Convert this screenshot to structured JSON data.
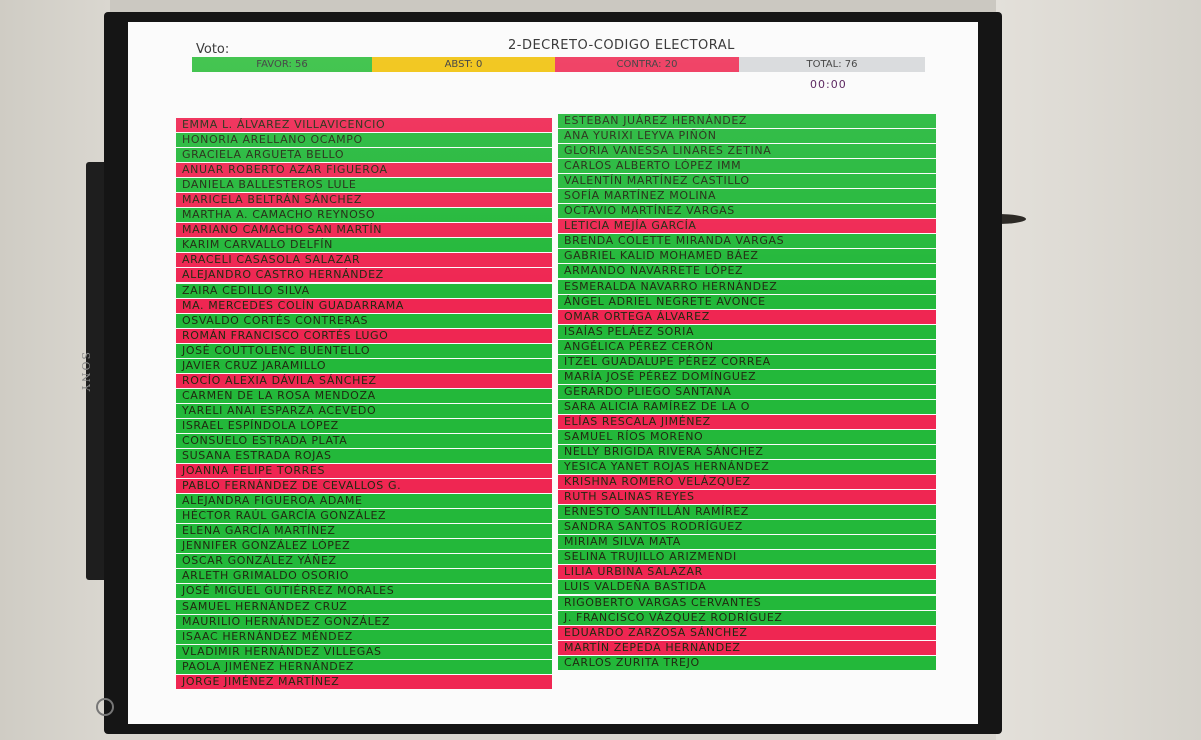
{
  "header": {
    "vote_label": "Voto:",
    "title": "2-DECRETO-CODIGO ELECTORAL",
    "favor": "FAVOR: 56",
    "abst": "ABST: 0",
    "contra": "CONTRA: 20",
    "total": "TOTAL: 76",
    "timer": "00:00"
  },
  "tv_brand": "SONY",
  "colors": {
    "favor": "#23b83a",
    "contra": "#ef2652",
    "abst": "#f1c20a",
    "total": "#d6d8da"
  },
  "left_column": [
    {
      "name": "EMMA L. ÁLVAREZ VILLAVICENCIO",
      "vote": "contra"
    },
    {
      "name": "HONORIA ARELLANO OCAMPO",
      "vote": "favor"
    },
    {
      "name": "GRACIELA ARGUETA BELLO",
      "vote": "favor"
    },
    {
      "name": "ANUAR ROBERTO AZAR FIGUEROA",
      "vote": "contra"
    },
    {
      "name": "DANIELA BALLESTEROS LULE",
      "vote": "favor"
    },
    {
      "name": "MARICELA BELTRÁN SÁNCHEZ",
      "vote": "contra"
    },
    {
      "name": "MARTHA A. CAMACHO REYNOSO",
      "vote": "favor"
    },
    {
      "name": "MARIANO CAMACHO SAN MARTÍN",
      "vote": "contra"
    },
    {
      "name": "KARIM CARVALLO DELFÍN",
      "vote": "favor"
    },
    {
      "name": "ARACELI CASASOLA SALAZAR",
      "vote": "contra"
    },
    {
      "name": "ALEJANDRO CASTRO HERNÁNDEZ",
      "vote": "contra"
    },
    {
      "name": "ZAIRA CEDILLO SILVA",
      "vote": "favor"
    },
    {
      "name": "MA. MERCEDES COLÍN GUADARRAMA",
      "vote": "contra"
    },
    {
      "name": "OSVALDO CORTÉS CONTRERAS",
      "vote": "favor"
    },
    {
      "name": "ROMÁN FRANCISCO CORTÉS LUGO",
      "vote": "contra"
    },
    {
      "name": "JOSÉ COUTTOLENC BUENTELLO",
      "vote": "favor"
    },
    {
      "name": "JAVIER CRUZ JARAMILLO",
      "vote": "favor"
    },
    {
      "name": "ROCÍO ALEXIA DÁVILA SÁNCHEZ",
      "vote": "contra"
    },
    {
      "name": "CARMEN DE LA ROSA MENDOZA",
      "vote": "favor"
    },
    {
      "name": "YARELI ANAI ESPARZA ACEVEDO",
      "vote": "favor"
    },
    {
      "name": "ISRAEL ESPÍNDOLA LÓPEZ",
      "vote": "favor"
    },
    {
      "name": "CONSUELO ESTRADA PLATA",
      "vote": "favor"
    },
    {
      "name": "SUSANA ESTRADA ROJAS",
      "vote": "favor"
    },
    {
      "name": "JOANNA FELIPE TORRES",
      "vote": "contra"
    },
    {
      "name": "PABLO FERNÁNDEZ DE CEVALLOS G.",
      "vote": "contra"
    },
    {
      "name": "ALEJANDRA FIGUEROA ADAME",
      "vote": "favor"
    },
    {
      "name": "HÉCTOR RAÚL GARCÍA GONZÁLEZ",
      "vote": "favor"
    },
    {
      "name": "ELENA GARCÍA MARTÍNEZ",
      "vote": "favor"
    },
    {
      "name": "JENNIFER GONZÁLEZ LÓPEZ",
      "vote": "favor"
    },
    {
      "name": "OSCAR GONZÁLEZ YÁÑEZ",
      "vote": "favor"
    },
    {
      "name": "ARLETH GRIMALDO OSORIO",
      "vote": "favor"
    },
    {
      "name": "JOSÉ MIGUEL GUTIÉRREZ MORALES",
      "vote": "favor"
    },
    {
      "name": "SAMUEL HERNÁNDEZ CRUZ",
      "vote": "favor"
    },
    {
      "name": "MAURILIO HERNÁNDEZ GONZÁLEZ",
      "vote": "favor"
    },
    {
      "name": "ISAAC HERNÁNDEZ MÉNDEZ",
      "vote": "favor"
    },
    {
      "name": "VLADIMIR HERNÁNDEZ VILLEGAS",
      "vote": "favor"
    },
    {
      "name": "PAOLA JIMÉNEZ HERNÁNDEZ",
      "vote": "favor"
    },
    {
      "name": "JORGE JIMÉNEZ MARTÍNEZ",
      "vote": "contra"
    }
  ],
  "right_column": [
    {
      "name": "ESTEBAN JUÁREZ HERNÁNDEZ",
      "vote": "favor"
    },
    {
      "name": "ANA YURIXI LEYVA PIÑÓN",
      "vote": "favor"
    },
    {
      "name": "GLORIA VANESSA LINARES ZETINA",
      "vote": "favor"
    },
    {
      "name": "CARLOS ALBERTO LÓPEZ IMM",
      "vote": "favor"
    },
    {
      "name": "VALENTÍN MARTÍNEZ CASTILLO",
      "vote": "favor"
    },
    {
      "name": "SOFÍA MARTÍNEZ MOLINA",
      "vote": "favor"
    },
    {
      "name": "OCTAVIO MARTÍNEZ VARGAS",
      "vote": "favor"
    },
    {
      "name": "LETICIA MEJÍA GARCÍA",
      "vote": "contra"
    },
    {
      "name": "BRENDA COLETTE MIRANDA VARGAS",
      "vote": "favor"
    },
    {
      "name": "GABRIEL KALID MOHAMED BÁEZ",
      "vote": "favor"
    },
    {
      "name": "ARMANDO NAVARRETE LÓPEZ",
      "vote": "favor"
    },
    {
      "name": "ESMERALDA NAVARRO HERNÁNDEZ",
      "vote": "favor"
    },
    {
      "name": "ÁNGEL ADRIEL NEGRETE AVONCE",
      "vote": "favor"
    },
    {
      "name": "OMAR ORTEGA ÁLVAREZ",
      "vote": "contra"
    },
    {
      "name": "ISAÍAS PELÁEZ SORIA",
      "vote": "favor"
    },
    {
      "name": "ANGÉLICA PÉREZ CERÓN",
      "vote": "favor"
    },
    {
      "name": "ITZEL GUADALUPE PÉREZ CORREA",
      "vote": "favor"
    },
    {
      "name": "MARÍA JOSÉ PÉREZ DOMÍNGUEZ",
      "vote": "favor"
    },
    {
      "name": "GERARDO PLIEGO SANTANA",
      "vote": "favor"
    },
    {
      "name": "SARA ALICIA RAMÍREZ DE LA O",
      "vote": "favor"
    },
    {
      "name": "ELÍAS RESCALA JIMÉNEZ",
      "vote": "contra"
    },
    {
      "name": "SAMUEL RÍOS MORENO",
      "vote": "favor"
    },
    {
      "name": "NELLY BRIGIDA RIVERA SÁNCHEZ",
      "vote": "favor"
    },
    {
      "name": "YESICA YANET ROJAS HERNÁNDEZ",
      "vote": "favor"
    },
    {
      "name": "KRISHNA ROMERO VELÁZQUEZ",
      "vote": "contra"
    },
    {
      "name": "RUTH SALINAS REYES",
      "vote": "contra"
    },
    {
      "name": "ERNESTO SANTILLÁN RAMÍREZ",
      "vote": "favor"
    },
    {
      "name": "SANDRA SANTOS RODRÍGUEZ",
      "vote": "favor"
    },
    {
      "name": "MIRIAM SILVA MATA",
      "vote": "favor"
    },
    {
      "name": "SELINA TRUJILLO ARIZMENDI",
      "vote": "favor"
    },
    {
      "name": "LILIA URBINA SALAZAR",
      "vote": "contra"
    },
    {
      "name": "LUIS VALDEÑA BASTIDA",
      "vote": "favor"
    },
    {
      "name": "RIGOBERTO VARGAS CERVANTES",
      "vote": "favor"
    },
    {
      "name": "J. FRANCISCO VÁZQUEZ RODRÍGUEZ",
      "vote": "favor"
    },
    {
      "name": "EDUARDO ZARZOSA SÁNCHEZ",
      "vote": "contra"
    },
    {
      "name": "MARTÍN ZEPEDA HERNÁNDEZ",
      "vote": "contra"
    },
    {
      "name": "CARLOS ZURITA TREJO",
      "vote": "favor"
    }
  ]
}
